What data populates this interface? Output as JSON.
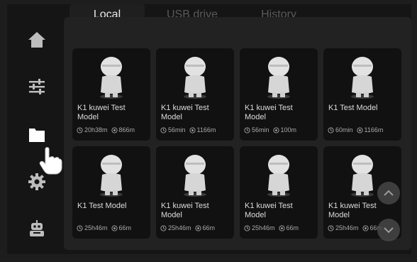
{
  "tabs": [
    {
      "label": "Local",
      "active": true
    },
    {
      "label": "USB drive",
      "active": false
    },
    {
      "label": "History",
      "active": false
    }
  ],
  "sidebar": {
    "items": [
      {
        "icon": "home-icon"
      },
      {
        "icon": "sliders-icon"
      },
      {
        "icon": "folder-icon",
        "active": true
      },
      {
        "icon": "gear-icon"
      },
      {
        "icon": "robot-icon"
      }
    ]
  },
  "files": [
    {
      "name": "K1 kuwei Test Model",
      "time": "20h38m",
      "size": "866m"
    },
    {
      "name": "K1 kuwei Test Model",
      "time": "56min",
      "size": "1166m"
    },
    {
      "name": "K1 kuwei Test Model",
      "time": "56min",
      "size": "100m"
    },
    {
      "name": "K1 Test Model",
      "time": "60min",
      "size": "1166m"
    },
    {
      "name": "K1 Test Model",
      "time": "25h46m",
      "size": "66m"
    },
    {
      "name": "K1 kuwei Test Model",
      "time": "25h46m",
      "size": "66m"
    },
    {
      "name": "K1 kuwei Test Model",
      "time": "25h46m",
      "size": "66m"
    },
    {
      "name": "K1 kuwei Test Model",
      "time": "25h46m",
      "size": "66m"
    }
  ],
  "colors": {
    "background": "#151515",
    "panel": "#222222",
    "card": "#111111",
    "active_icon": "#ffffff",
    "inactive_icon": "#bdbdbd"
  }
}
